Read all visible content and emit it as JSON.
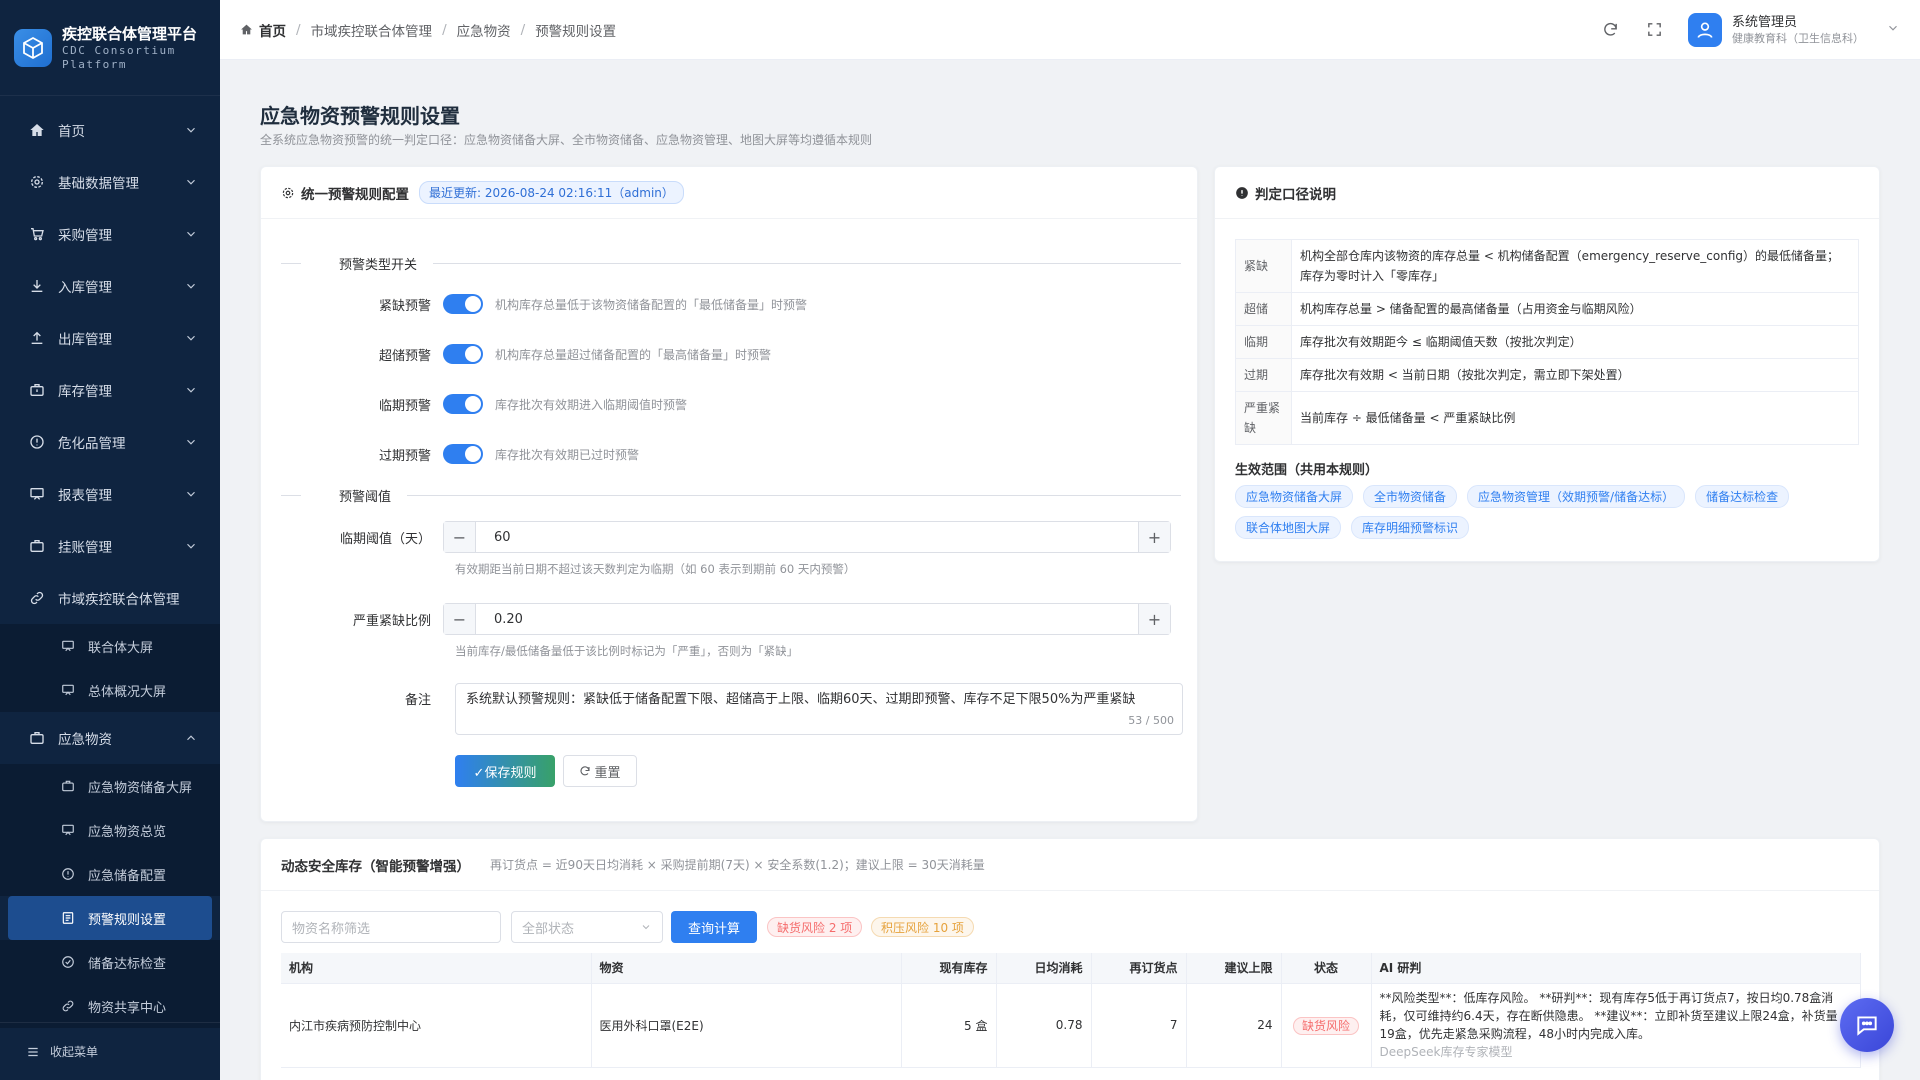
{
  "app": {
    "title": "疾控联合体管理平台",
    "subtitle": "CDC Consortium Platform"
  },
  "sidebar": {
    "items": [
      {
        "label": "首页"
      },
      {
        "label": "基础数据管理"
      },
      {
        "label": "采购管理"
      },
      {
        "label": "入库管理"
      },
      {
        "label": "出库管理"
      },
      {
        "label": "库存管理"
      },
      {
        "label": "危化品管理"
      },
      {
        "label": "报表管理"
      },
      {
        "label": "挂账管理"
      },
      {
        "label": "市域疾控联合体管理"
      },
      {
        "label": "应急物资"
      }
    ],
    "sub_city": [
      {
        "label": "联合体大屏"
      },
      {
        "label": "总体概况大屏"
      }
    ],
    "sub_emergency": [
      {
        "label": "应急物资储备大屏"
      },
      {
        "label": "应急物资总览"
      },
      {
        "label": "应急储备配置"
      },
      {
        "label": "预警规则设置"
      },
      {
        "label": "储备达标检查"
      },
      {
        "label": "物资共享中心"
      }
    ],
    "collapse_label": "收起菜单"
  },
  "header": {
    "breadcrumb": [
      "首页",
      "市域疾控联合体管理",
      "应急物资",
      "预警规则设置"
    ],
    "user_name": "系统管理员",
    "user_role": "健康教育科（卫生信息科）"
  },
  "page": {
    "title": "应急物资预警规则设置",
    "subtitle": "全系统应急物资预警的统一判定口径：应急物资储备大屏、全市物资储备、应急物资管理、地图大屏等均遵循本规则"
  },
  "config": {
    "title": "统一预警规则配置",
    "updated": "最近更新: 2026-08-24 02:16:11（admin）",
    "section_switch": "预警类型开关",
    "switches": [
      {
        "label": "紧缺预警",
        "desc": "机构库存总量低于该物资储备配置的「最低储备量」时预警"
      },
      {
        "label": "超储预警",
        "desc": "机构库存总量超过储备配置的「最高储备量」时预警"
      },
      {
        "label": "临期预警",
        "desc": "库存批次有效期进入临期阈值时预警"
      },
      {
        "label": "过期预警",
        "desc": "库存批次有效期已过时预警"
      }
    ],
    "section_threshold": "预警阈值",
    "expiry_label": "临期阈值（天）",
    "expiry_value": "60",
    "expiry_hint": "有效期距当前日期不超过该天数判定为临期（如 60 表示到期前 60 天内预警）",
    "ratio_label": "严重紧缺比例",
    "ratio_value": "0.20",
    "ratio_hint": "当前库存/最低储备量低于该比例时标记为「严重」，否则为「紧缺」",
    "remark_label": "备注",
    "remark_value": "系统默认预警规则：紧缺低于储备配置下限、超储高于上限、临期60天、过期即预警、库存不足下限50%为严重紧缺",
    "remark_count": "53 / 500",
    "save_label": "✓保存规则",
    "reset_label": "重置"
  },
  "rules": {
    "title": "判定口径说明",
    "rows": [
      {
        "k": "紧缺",
        "v": "机构全部仓库内该物资的库存总量 < 机构储备配置（emergency_reserve_config）的最低储备量；库存为零时计入「零库存」"
      },
      {
        "k": "超储",
        "v": "机构库存总量 > 储备配置的最高储备量（占用资金与临期风险）"
      },
      {
        "k": "临期",
        "v": "库存批次有效期距今 ≤ 临期阈值天数（按批次判定）"
      },
      {
        "k": "过期",
        "v": "库存批次有效期 < 当前日期（按批次判定，需立即下架处置）"
      },
      {
        "k": "严重紧缺",
        "v": "当前库存 ÷ 最低储备量 < 严重紧缺比例"
      }
    ],
    "scope_title": "生效范围（共用本规则）",
    "scope_tags": [
      "应急物资储备大屏",
      "全市物资储备",
      "应急物资管理（效期预警/储备达标）",
      "储备达标检查",
      "联合体地图大屏",
      "库存明细预警标识"
    ]
  },
  "dynamic": {
    "title": "动态安全库存（智能预警增强）",
    "formula": "再订货点 = 近90天日均消耗 × 采购提前期(7天) × 安全系数(1.2)；建议上限 = 30天消耗量",
    "search_placeholder": "物资名称筛选",
    "status_placeholder": "全部状态",
    "query_label": "查询计算",
    "shortage_tag": "缺货风险 2 项",
    "overstock_tag": "积压风险 10 项",
    "columns": [
      "机构",
      "物资",
      "现有库存",
      "日均消耗",
      "再订货点",
      "建议上限",
      "状态",
      "AI 研判"
    ],
    "rows": [
      {
        "org": "内江市疾病预防控制中心",
        "item": "医用外科口罩(E2E)",
        "stock": "5 盒",
        "daily": "0.78",
        "reorder": "7",
        "upper": "24",
        "status": "缺货风险",
        "ai": "**风险类型**：低库存风险。 **研判**：现有库存5低于再订货点7，按日均0.78盒消耗，仅可维持约6.4天，存在断供隐患。 **建议**：立即补货至建议上限24盒，补货量19盒，优先走紧急采购流程，48小时内完成入库。",
        "model": "DeepSeek库存专家模型"
      }
    ]
  }
}
